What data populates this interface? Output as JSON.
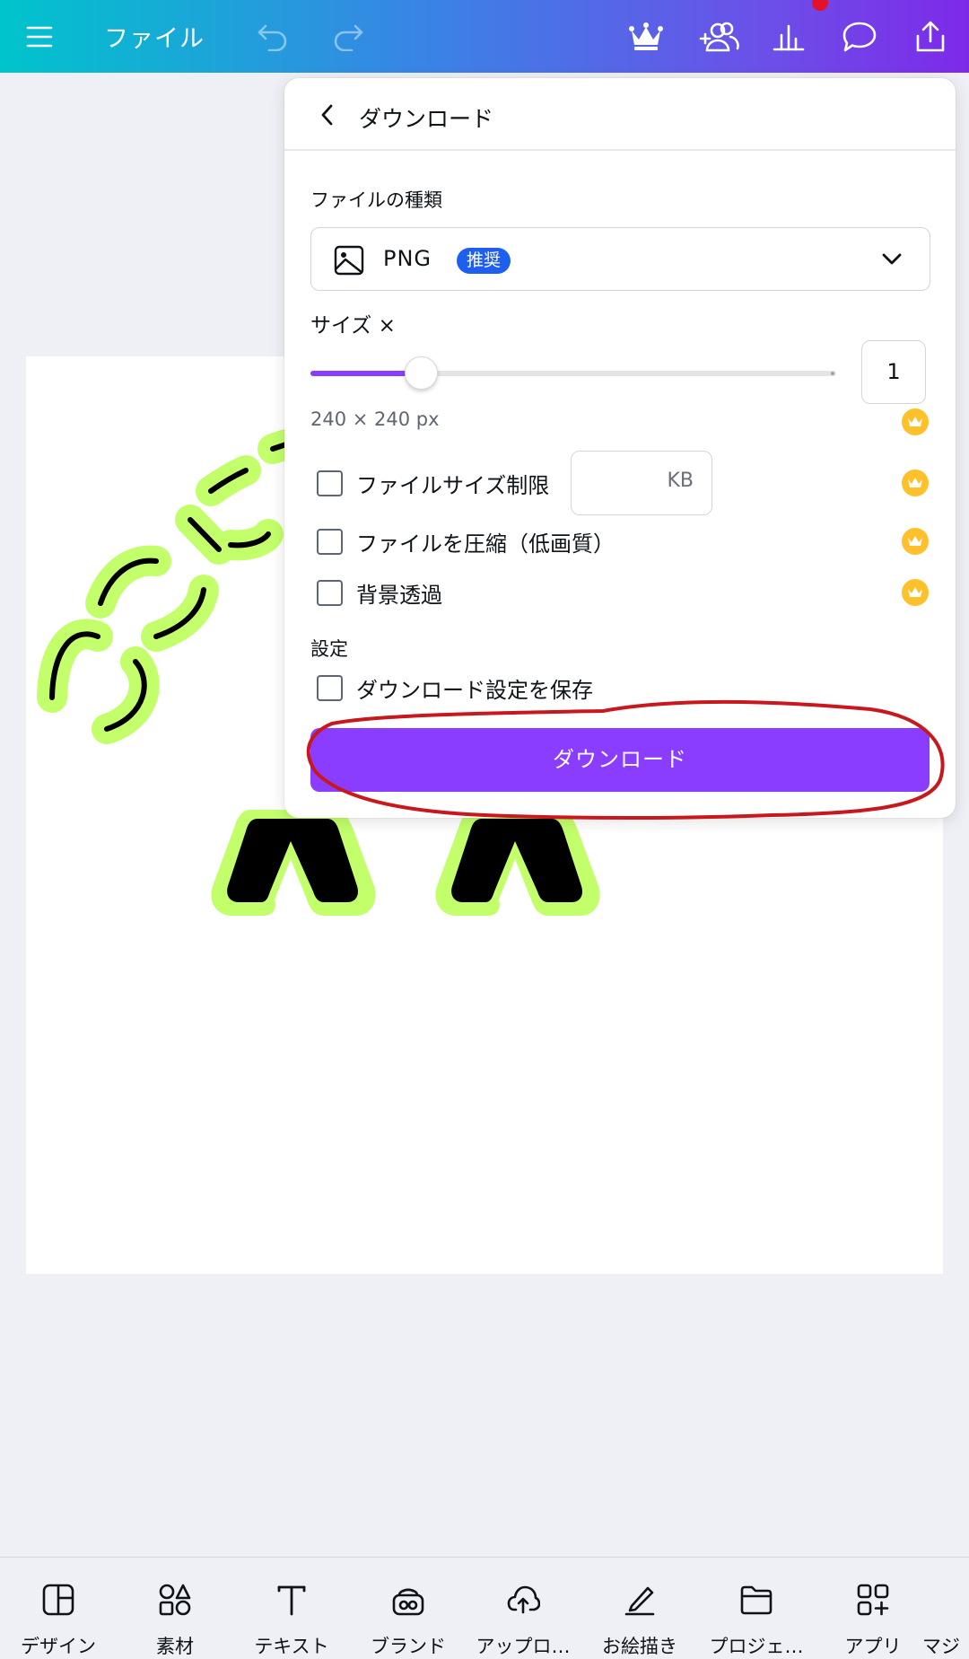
{
  "topbar": {
    "file_label": "ファイル",
    "icons": [
      "menu-icon",
      "undo-icon",
      "redo-icon",
      "crown-icon",
      "add-people-icon",
      "insights-icon",
      "comment-icon",
      "share-icon"
    ]
  },
  "panel": {
    "title": "ダウンロード",
    "file_type_label": "ファイルの種類",
    "file_type_value": "PNG",
    "recommended_badge": "推奨",
    "size_label": "サイズ ×",
    "size_value": "1",
    "size_slider_fraction": 0.21,
    "dimensions": "240 × 240 px",
    "options": [
      {
        "label": "ファイルサイズ制限",
        "checked": false,
        "pro": true
      },
      {
        "label": "ファイルを圧縮（低画質）",
        "checked": false,
        "pro": true
      },
      {
        "label": "背景透過",
        "checked": false,
        "pro": true
      }
    ],
    "kb_unit": "KB",
    "settings_label": "設定",
    "save_settings_label": "ダウンロード設定を保存",
    "download_button": "ダウンロード"
  },
  "bottom_nav": [
    {
      "label": "デザイン",
      "icon": "design-icon"
    },
    {
      "label": "素材",
      "icon": "elements-icon"
    },
    {
      "label": "テキスト",
      "icon": "text-icon"
    },
    {
      "label": "ブランド",
      "icon": "brand-icon"
    },
    {
      "label": "アップロ…",
      "icon": "upload-icon"
    },
    {
      "label": "お絵描き",
      "icon": "draw-icon"
    },
    {
      "label": "プロジェ…",
      "icon": "projects-icon"
    },
    {
      "label": "アプリ",
      "icon": "apps-icon"
    },
    {
      "label": "マジ",
      "icon": "magic-icon"
    }
  ],
  "colors": {
    "accent": "#8b3dff",
    "badge": "#1f5ff0",
    "pro_crown": "#ffc12b",
    "annotation": "#c8181e",
    "canvas_lime": "#c3ff6b"
  }
}
